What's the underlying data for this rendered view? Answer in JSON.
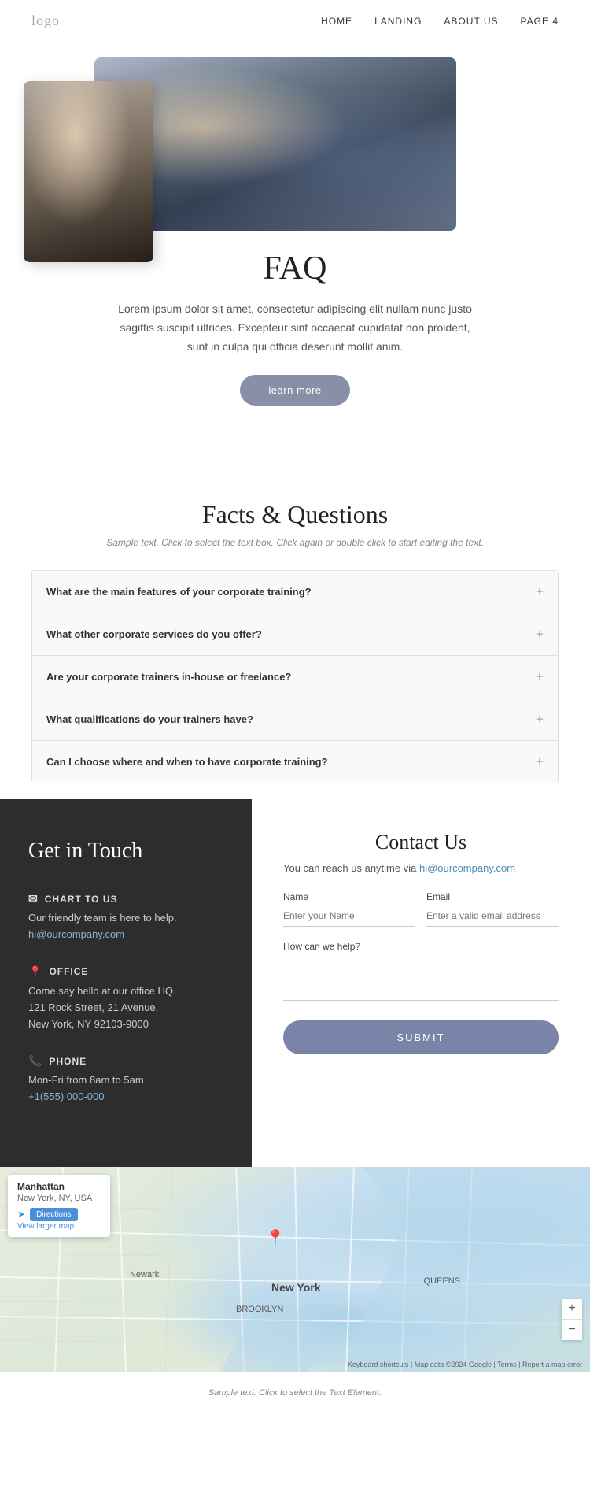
{
  "navbar": {
    "logo": "logo",
    "links": [
      "HOME",
      "LANDING",
      "ABOUT US",
      "PAGE 4"
    ]
  },
  "hero": {
    "title": "FAQ",
    "description": "Lorem ipsum dolor sit amet, consectetur adipiscing elit nullam nunc justo sagittis suscipit ultrices. Excepteur sint occaecat cupidatat non proident, sunt in culpa qui officia deserunt mollit anim.",
    "button_label": "learn more"
  },
  "faq_section": {
    "title": "Facts & Questions",
    "subtitle": "Sample text. Click to select the text box. Click again or double click to start editing the text.",
    "items": [
      "What are the main features of your corporate training?",
      "What other corporate services do you offer?",
      "Are your corporate trainers in-house or freelance?",
      "What qualifications do your trainers have?",
      "Can I choose where and when to have corporate training?"
    ]
  },
  "contact_left": {
    "title": "Get in Touch",
    "chart_label": "CHART TO US",
    "chart_desc": "Our friendly team is here to help.",
    "chart_email": "hi@ourcompany.com",
    "office_label": "OFFICE",
    "office_desc1": "Come say hello at our office HQ.",
    "office_address": "121 Rock Street, 21 Avenue,\nNew York, NY 92103-9000",
    "phone_label": "PHONE",
    "phone_hours": "Mon-Fri from 8am to 5am",
    "phone_number": "+1(555) 000-000"
  },
  "contact_right": {
    "title": "Contact Us",
    "reach_text": "You can reach us anytime via",
    "reach_email": "hi@ourcompany.com",
    "name_label": "Name",
    "name_placeholder": "Enter your Name",
    "email_label": "Email",
    "email_placeholder": "Enter a valid email address",
    "message_label": "How can we help?",
    "submit_label": "SUBMIT"
  },
  "map": {
    "popup_title": "Manhattan",
    "popup_address": "New York, NY, USA",
    "directions_btn": "Directions",
    "larger_map_link": "View larger map",
    "label_ny": "New York",
    "label_brooklyn": "BROOKLYN",
    "label_newark": "Newark",
    "label_queens": "QUEENS"
  },
  "footer": {
    "text": "Sample text. Click to select the Text Element."
  }
}
